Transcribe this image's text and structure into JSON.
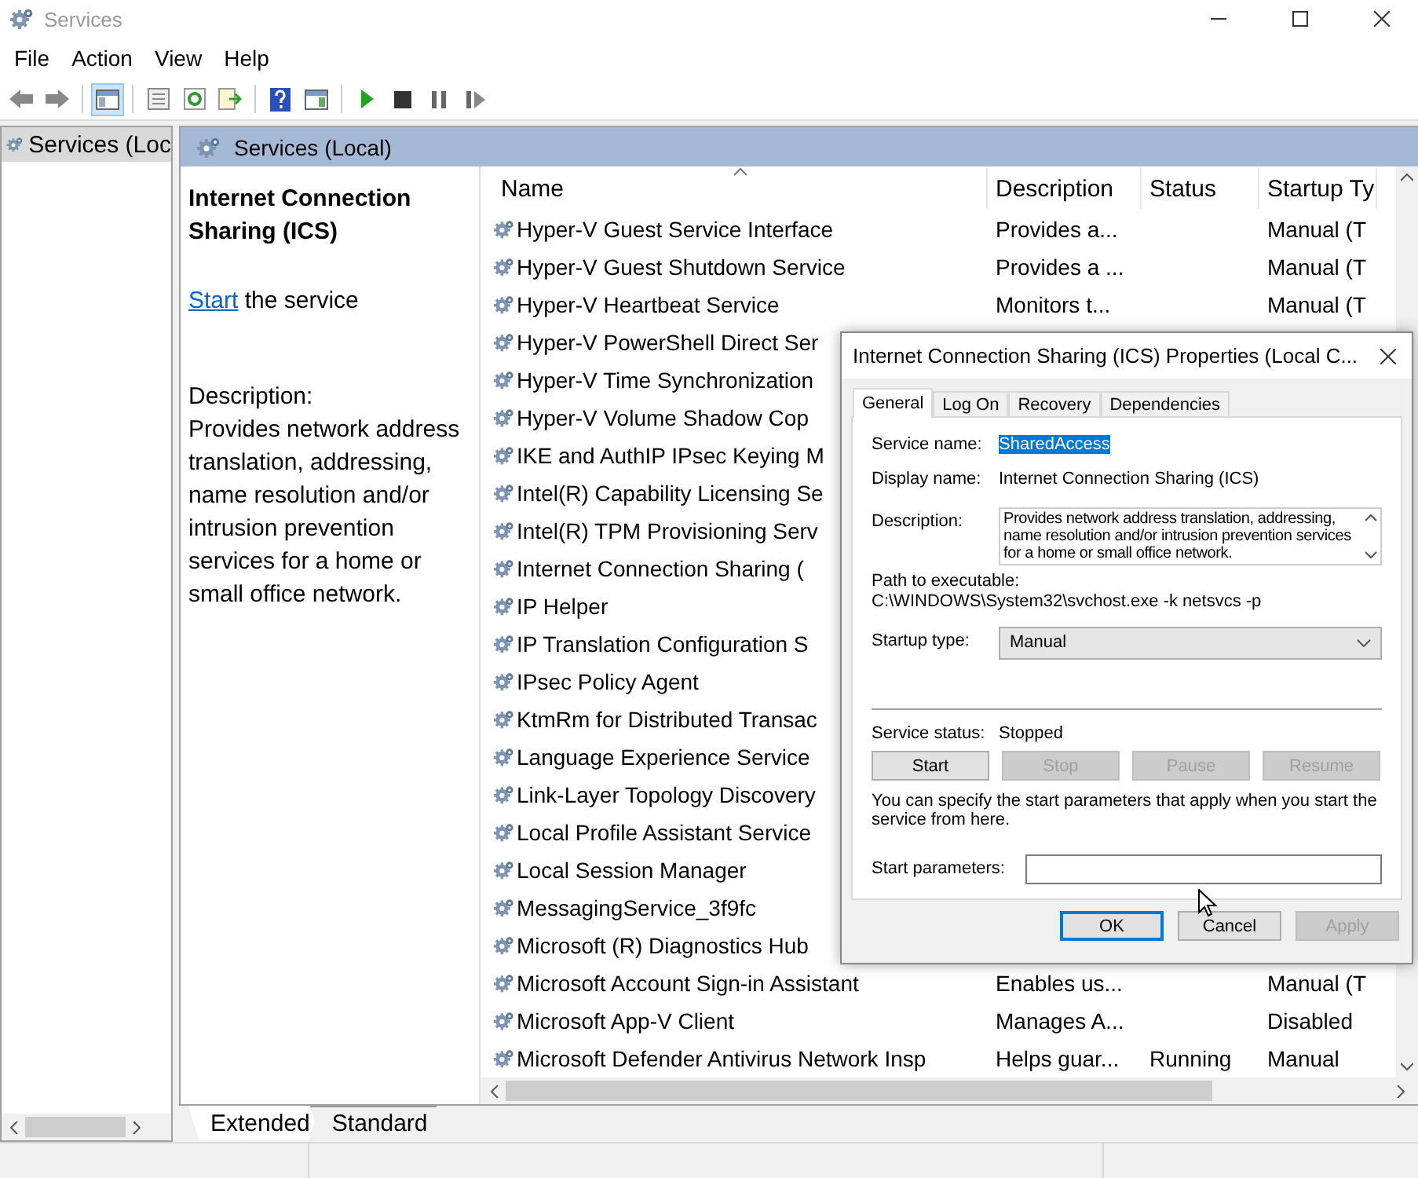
{
  "window": {
    "title": "Services"
  },
  "menu": [
    "File",
    "Action",
    "View",
    "Help"
  ],
  "tree": [
    {
      "label": "Services (Loc",
      "selected": true
    }
  ],
  "pane_header": "Services (Local)",
  "details": {
    "title": "Internet Connection Sharing (ICS)",
    "link": "Start",
    "link_rest": "the service",
    "description_label": "Description:",
    "description": "Provides network address translation, addressing, name resolution and/or intrusion prevention services for a home or small office network."
  },
  "table": {
    "columns": [
      {
        "label": "Name",
        "sorted": true
      },
      {
        "label": "Description",
        "sorted": false
      },
      {
        "label": "Status",
        "sorted": false
      },
      {
        "label": "Startup Ty",
        "sorted": false
      }
    ],
    "rows": [
      {
        "name": "Hyper-V Guest Service Interface",
        "description": "Provides a...",
        "startup": "Manual (T"
      },
      {
        "name": "Hyper-V Guest Shutdown Service",
        "description": "Provides a ...",
        "startup": "Manual (T"
      },
      {
        "name": "Hyper-V Heartbeat Service",
        "description": "Monitors t...",
        "startup": "Manual (T"
      },
      {
        "name": "Hyper-V PowerShell Direct Ser"
      },
      {
        "name": "Hyper-V Time Synchronization"
      },
      {
        "name": "Hyper-V Volume Shadow Cop"
      },
      {
        "name": "IKE and AuthIP IPsec Keying M"
      },
      {
        "name": "Intel(R) Capability Licensing Se"
      },
      {
        "name": "Intel(R) TPM Provisioning Serv"
      },
      {
        "name": "Internet Connection Sharing ("
      },
      {
        "name": "IP Helper"
      },
      {
        "name": "IP Translation Configuration S"
      },
      {
        "name": "IPsec Policy Agent"
      },
      {
        "name": "KtmRm for Distributed Transac"
      },
      {
        "name": "Language Experience Service"
      },
      {
        "name": "Link-Layer Topology Discovery"
      },
      {
        "name": "Local Profile Assistant Service"
      },
      {
        "name": "Local Session Manager"
      },
      {
        "name": "MessagingService_3f9fc"
      },
      {
        "name": "Microsoft (R) Diagnostics Hub"
      },
      {
        "name": "Microsoft Account Sign-in Assistant",
        "description": "Enables us...",
        "startup": "Manual (T"
      },
      {
        "name": "Microsoft App-V Client",
        "description": "Manages A...",
        "startup": "Disabled"
      },
      {
        "name": "Microsoft Defender Antivirus Network Insp",
        "description": "Helps guar...",
        "status": "Running",
        "startup": "Manual"
      }
    ]
  },
  "view_tabs": [
    {
      "label": "Extended",
      "selected": true
    },
    {
      "label": "Standard",
      "selected": false
    }
  ],
  "dialog": {
    "title": "Internet Connection Sharing (ICS) Properties (Local C...",
    "tabs": [
      {
        "label": "General",
        "selected": true
      },
      {
        "label": "Log On",
        "selected": false
      },
      {
        "label": "Recovery",
        "selected": false
      },
      {
        "label": "Dependencies",
        "selected": false
      }
    ],
    "service_name_label": "Service name:",
    "service_name": "SharedAccess",
    "service_name_highlighted": true,
    "display_name_label": "Display name:",
    "display_name": "Internet Connection Sharing (ICS)",
    "description_label": "Description:",
    "description": "Provides network address translation, addressing, name resolution and/or intrusion prevention services for a home or small office network.",
    "path_label": "Path to executable:",
    "path": "C:\\WINDOWS\\System32\\svchost.exe -k netsvcs -p",
    "startup_label": "Startup type:",
    "startup_type": "Manual",
    "status_label": "Service status:",
    "status": "Stopped",
    "control_buttons": [
      {
        "label": "Start",
        "disabled": false
      },
      {
        "label": "Stop",
        "disabled": true
      },
      {
        "label": "Pause",
        "disabled": true
      },
      {
        "label": "Resume",
        "disabled": true
      }
    ],
    "hint": "You can specify the start parameters that apply when you start the service from here.",
    "params_label": "Start parameters:",
    "buttons": [
      {
        "label": "OK",
        "default": true,
        "disabled": false
      },
      {
        "label": "Cancel",
        "default": false,
        "disabled": false
      },
      {
        "label": "Apply",
        "default": false,
        "disabled": true
      }
    ]
  }
}
